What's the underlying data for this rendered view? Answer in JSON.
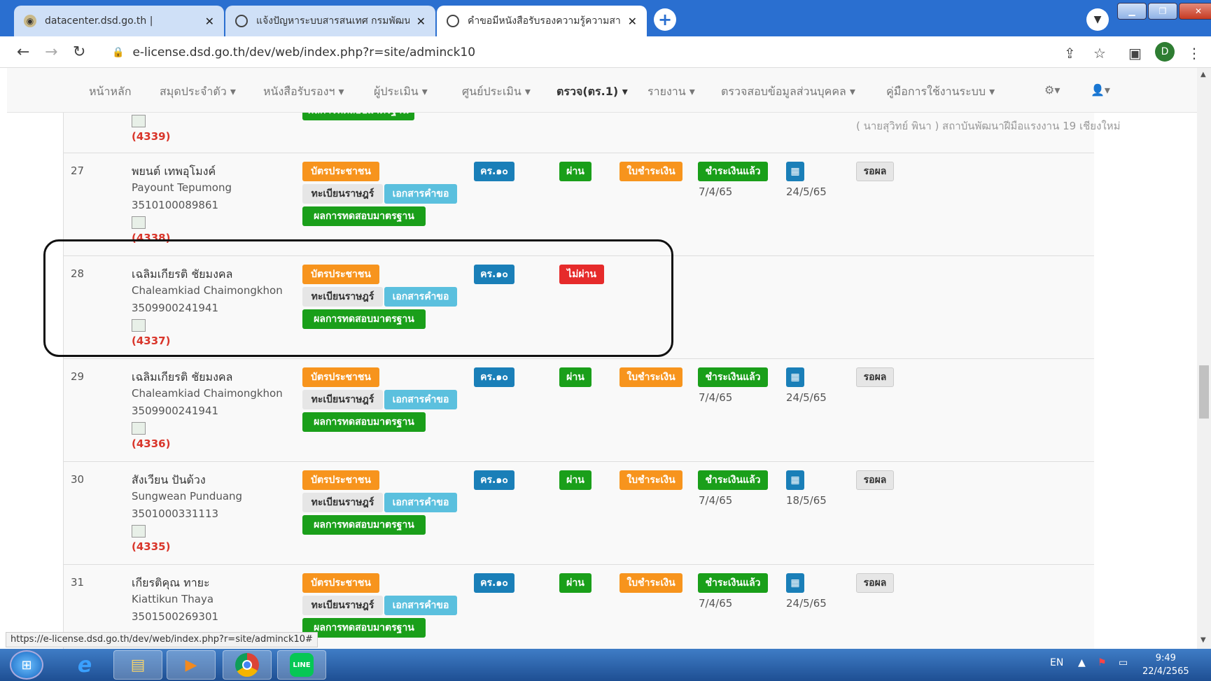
{
  "browser": {
    "tabs": [
      {
        "title": "datacenter.dsd.go.th |",
        "active": false
      },
      {
        "title": "แจ้งปัญหาระบบสารสนเทศ กรมพัฒนาฝี",
        "active": false
      },
      {
        "title": "คำขอมีหนังสือรับรองความรู้ความสามารถ",
        "active": true
      }
    ],
    "url": "e-license.dsd.go.th/dev/web/index.php?r=site/adminck10",
    "profile_initial": "D"
  },
  "nav": {
    "items": [
      "หน้าหลัก",
      "สมุดประจำตัว ▾",
      "หนังสือรับรองฯ ▾",
      "ผู้ประเมิน ▾",
      "ศูนย์ประเมิน ▾",
      "ตรวจ(ตร.1) ▾",
      "รายงาน ▾",
      "ตรวจสอบข้อมูลส่วนบุคคล ▾",
      "คู่มือการใช้งานระบบ ▾"
    ],
    "active_index": 5
  },
  "partial_row": {
    "code": "(4339)",
    "assessor": "( นายสุวิทย์ พินา ) สถาบันพัฒนาฝีมือแรงงาน 19 เชียงใหม่"
  },
  "labels": {
    "id_card": "บัตรประชาชน",
    "house_reg": "ทะเบียนราษฎร์",
    "request_doc": "เอกสารคำขอ",
    "test_result": "ผลการทดสอบมาตรฐาน",
    "form": "คร.๑๐",
    "pass": "ผ่าน",
    "fail": "ไม่ผ่าน",
    "invoice": "ใบชำระเงิน",
    "paid": "ชำระเงินแล้ว",
    "pending": "รอผล"
  },
  "rows": [
    {
      "no": "27",
      "name_th": "พยนต์ เทพอุโมงค์",
      "name_en": "Payount Tepumong",
      "id": "3510100089861",
      "code": "(4338)",
      "status": "pass",
      "paid_date": "7/4/65",
      "cal_date": "24/5/65"
    },
    {
      "no": "28",
      "name_th": "เฉลิมเกียรติ ชัยมงคล",
      "name_en": "Chaleamkiad Chaimongkhon",
      "id": "3509900241941",
      "code": "(4337)",
      "status": "fail",
      "paid_date": "",
      "cal_date": ""
    },
    {
      "no": "29",
      "name_th": "เฉลิมเกียรติ ชัยมงคล",
      "name_en": "Chaleamkiad Chaimongkhon",
      "id": "3509900241941",
      "code": "(4336)",
      "status": "pass",
      "paid_date": "7/4/65",
      "cal_date": "24/5/65"
    },
    {
      "no": "30",
      "name_th": "สังเวียน ปันด้วง",
      "name_en": "Sungwean Punduang",
      "id": "3501000331113",
      "code": "(4335)",
      "status": "pass",
      "paid_date": "7/4/65",
      "cal_date": "18/5/65"
    },
    {
      "no": "31",
      "name_th": "เกียรติคุณ ทายะ",
      "name_en": "Kiattikun Thaya",
      "id": "3501500269301",
      "code": "",
      "status": "pass",
      "paid_date": "7/4/65",
      "cal_date": "24/5/65"
    }
  ],
  "status_url": "https://e-license.dsd.go.th/dev/web/index.php?r=site/adminck10#",
  "taskbar": {
    "lang": "EN",
    "time": "9:49",
    "date": "22/4/2565"
  }
}
